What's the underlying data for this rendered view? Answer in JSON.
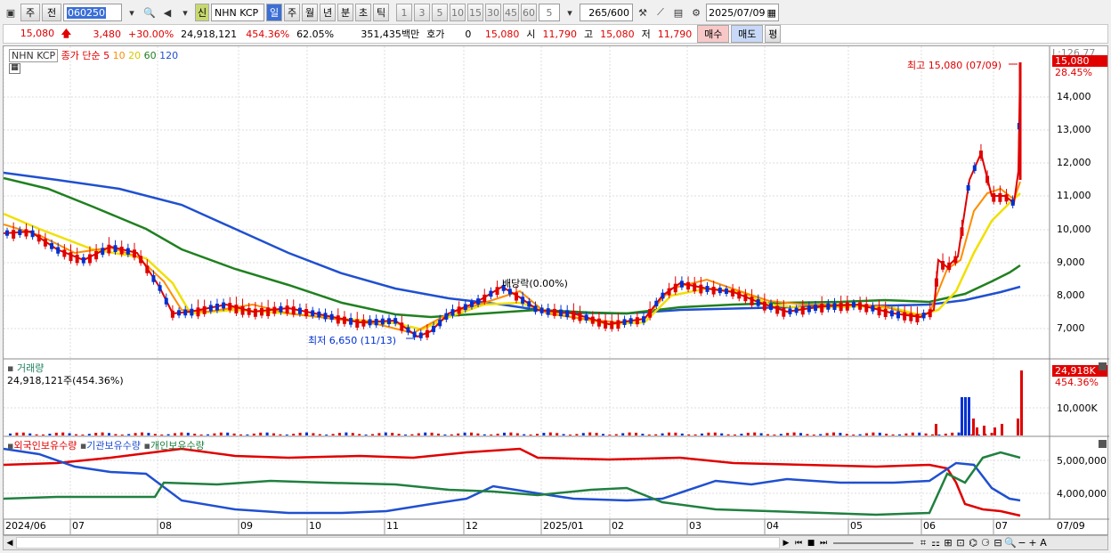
{
  "toolbar": {
    "period_left": "주",
    "prev_label": "전",
    "code": "060250",
    "badge_new": "신",
    "stock_name": "NHN KCP",
    "periods": [
      "일",
      "주",
      "월",
      "년",
      "분",
      "초",
      "틱"
    ],
    "period_selected": "일",
    "intervals": [
      "1",
      "3",
      "5",
      "10",
      "15",
      "30",
      "45",
      "60"
    ],
    "interval_custom": "5",
    "count": "265",
    "count_max": "/600",
    "date": "2025/07/09"
  },
  "quote": {
    "price": "15,080",
    "change": "3,480",
    "change_pct": "+30.00%",
    "volume": "24,918,121",
    "volume_pct": "454.36%",
    "turnover": "62.05%",
    "amount": "351,435백만",
    "bid_label": "호가",
    "bid_value": "0",
    "bid_price": "15,080",
    "open_label": "시",
    "open": "11,790",
    "high_label": "고",
    "high": "15,080",
    "low_label": "저",
    "low": "11,790",
    "buy": "매수",
    "sell": "매도",
    "eval": "평"
  },
  "price_panel": {
    "title": "NHN KCP",
    "ma_title": "종가 단순",
    "ma": [
      {
        "label": "5",
        "color": "#e00000"
      },
      {
        "label": "10",
        "color": "#ff8c00"
      },
      {
        "label": "20",
        "color": "#f0e000"
      },
      {
        "label": "60",
        "color": "#208020"
      },
      {
        "label": "120",
        "color": "#2050d0"
      }
    ],
    "scale_top_label": "L:126.77",
    "current_tag": "15,080",
    "current_pct": "28.45%",
    "y_ticks": [
      "14,000",
      "13,000",
      "12,000",
      "11,000",
      "10,000",
      "9,000",
      "8,000",
      "7,000"
    ],
    "high_note": "최고 15,080 (07/09)",
    "low_note": "최저 6,650 (11/13)",
    "dividend_note": "배당락(0.00%)"
  },
  "volume_panel": {
    "title": "거래량",
    "subtitle": "24,918,121주(454.36%)",
    "current_tag": "24,918K",
    "current_pct": "454.36%",
    "y_tick": "10,000K"
  },
  "holding_panel": {
    "legend": [
      {
        "label": "외국인보유수량",
        "color": "#e00000"
      },
      {
        "label": "기관보유수량",
        "color": "#2050d0"
      },
      {
        "label": "개인보유수량",
        "color": "#208040"
      }
    ],
    "y_ticks": [
      "5,000,000",
      "4,000,000"
    ]
  },
  "x_axis": [
    "2024/06",
    "07",
    "08",
    "09",
    "10",
    "11",
    "12",
    "2025/01",
    "02",
    "03",
    "04",
    "05",
    "06",
    "07"
  ],
  "x_axis_last": "07/09",
  "colors": {
    "accent_blue": "#3b6fd6",
    "up": "#e00000",
    "down": "#0030d0",
    "ma5": "#e00000",
    "ma10": "#ff8c00",
    "ma20": "#f0e000",
    "ma60": "#208020",
    "ma120": "#2050d0"
  }
}
